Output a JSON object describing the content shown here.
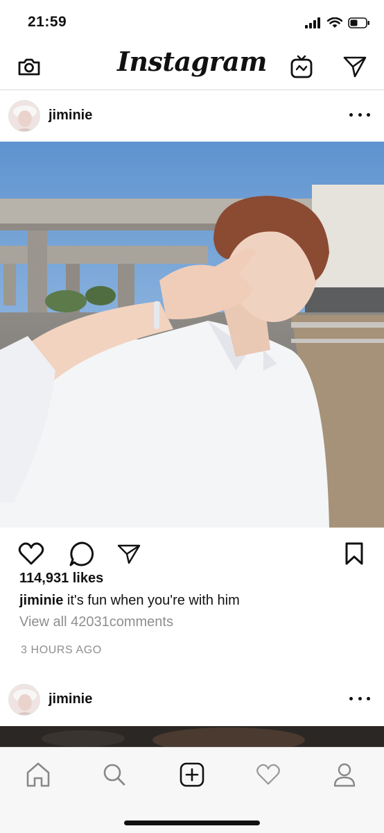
{
  "status_bar": {
    "time": "21:59"
  },
  "header": {
    "logo": "Instagram",
    "icons": {
      "camera": "camera-icon",
      "igtv": "igtv-icon",
      "direct": "direct-message-icon"
    }
  },
  "posts": [
    {
      "username": "jiminie",
      "likes": "114,931 likes",
      "caption_user": "jiminie",
      "caption_text": " it's fun when you're with him",
      "view_comments": "View all 42031comments",
      "timestamp": "3 HOURS AGO"
    },
    {
      "username": "jiminie"
    }
  ],
  "actions": {
    "icons": [
      "heart-icon",
      "comment-icon",
      "share-icon",
      "bookmark-icon"
    ]
  },
  "tab_bar": {
    "icons": [
      "home-icon",
      "search-icon",
      "add-post-icon",
      "activity-heart-icon",
      "profile-icon"
    ]
  },
  "colors": {
    "text": "#111111",
    "muted": "#8e8e8e",
    "divider": "#dbdbdb",
    "tabbar_bg": "#f7f7f7"
  }
}
